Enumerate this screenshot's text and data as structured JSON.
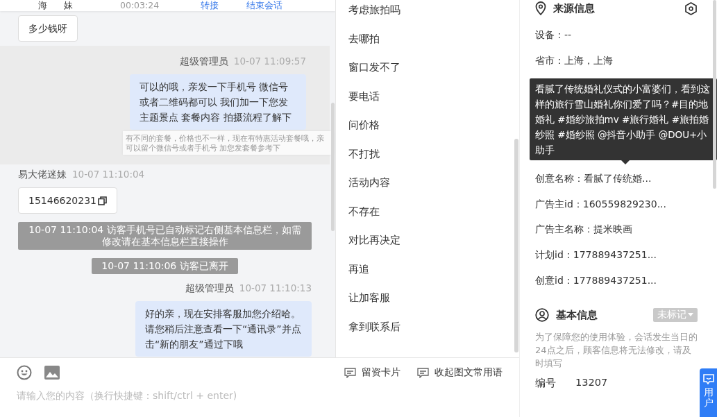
{
  "header": {
    "visitor_name": [
      "海",
      "妹"
    ],
    "duration": "00:03:24",
    "actions": [
      "转接",
      "结束会话"
    ]
  },
  "messages": [
    {
      "kind": "visitor",
      "highlighted": false,
      "text": "多少钱呀",
      "copyable": false
    },
    {
      "kind": "agent",
      "highlighted": true,
      "sender": "超级管理员",
      "time": "10-07 11:09:57",
      "text": "可以的哦，亲发一下手机号 微信号或者二维码都可以 我们加一下您发主题景点 套餐内容 拍摄流程了解下",
      "hint": "有不同的套餐，价格也不一样，现在有特惠活动套餐哦，亲可以留个微信号或者手机号 加您发套餐参考下"
    },
    {
      "kind": "visitor",
      "highlighted": false,
      "sender": "易大佬迷妹",
      "time": "10-07 11:10:04",
      "text": "15146620231",
      "copyable": true
    },
    {
      "kind": "system",
      "highlighted": false,
      "text": "10-07 11:10:04 访客手机号已自动标记右侧基本信息栏，如需修改请在基本信息栏直接操作"
    },
    {
      "kind": "system",
      "highlighted": false,
      "text": "10-07 11:10:06 访客已离开"
    },
    {
      "kind": "agent",
      "highlighted": false,
      "sender": "超级管理员",
      "time": "10-07 11:10:13",
      "text": "好的亲，现在安排客服加您介绍哈。请您稍后注意查看一下“通讯录”并点击“新的朋友”通过下哦"
    }
  ],
  "composer": {
    "tools": [
      "留资卡片",
      "收起图文常用语"
    ],
    "placeholder": "请输入您的内容（换行快捷键：shift/ctrl + enter)"
  },
  "phrases": [
    "考虑旅拍吗",
    "去哪拍",
    "窗口发不了",
    "要电话",
    "问价格",
    "不打扰",
    "活动内容",
    "不存在",
    "对比再决定",
    "再追",
    "让加客服",
    "拿到联系后"
  ],
  "source_info": {
    "title": "来源信息",
    "rows_before": [
      "设备：--",
      "省市：上海，上海"
    ],
    "tooltip": "看腻了传统婚礼仪式的小富婆们，看到这样的旅行雪山婚礼你们爱了吗？#目的地婚礼 #婚纱旅拍mv #旅行婚礼 #旅拍婚纱照 #婚纱照 @抖音小助手 @DOU+小助手",
    "rows_after": [
      "创意名称：看腻了传统婚...",
      "广告主id：160559829230...",
      "广告主名称：提米映画",
      "计划id：177889437251...",
      "创意id：177889437251..."
    ]
  },
  "basic_info": {
    "title": "基本信息",
    "tag": "未标记",
    "note": "为了保障您的使用体验，会话发生当日的24点之后，顾客信息将无法修改，请及时填写",
    "fields": [
      {
        "label": "编号",
        "value": "13207"
      }
    ]
  },
  "float_button": {
    "label": "用户"
  }
}
